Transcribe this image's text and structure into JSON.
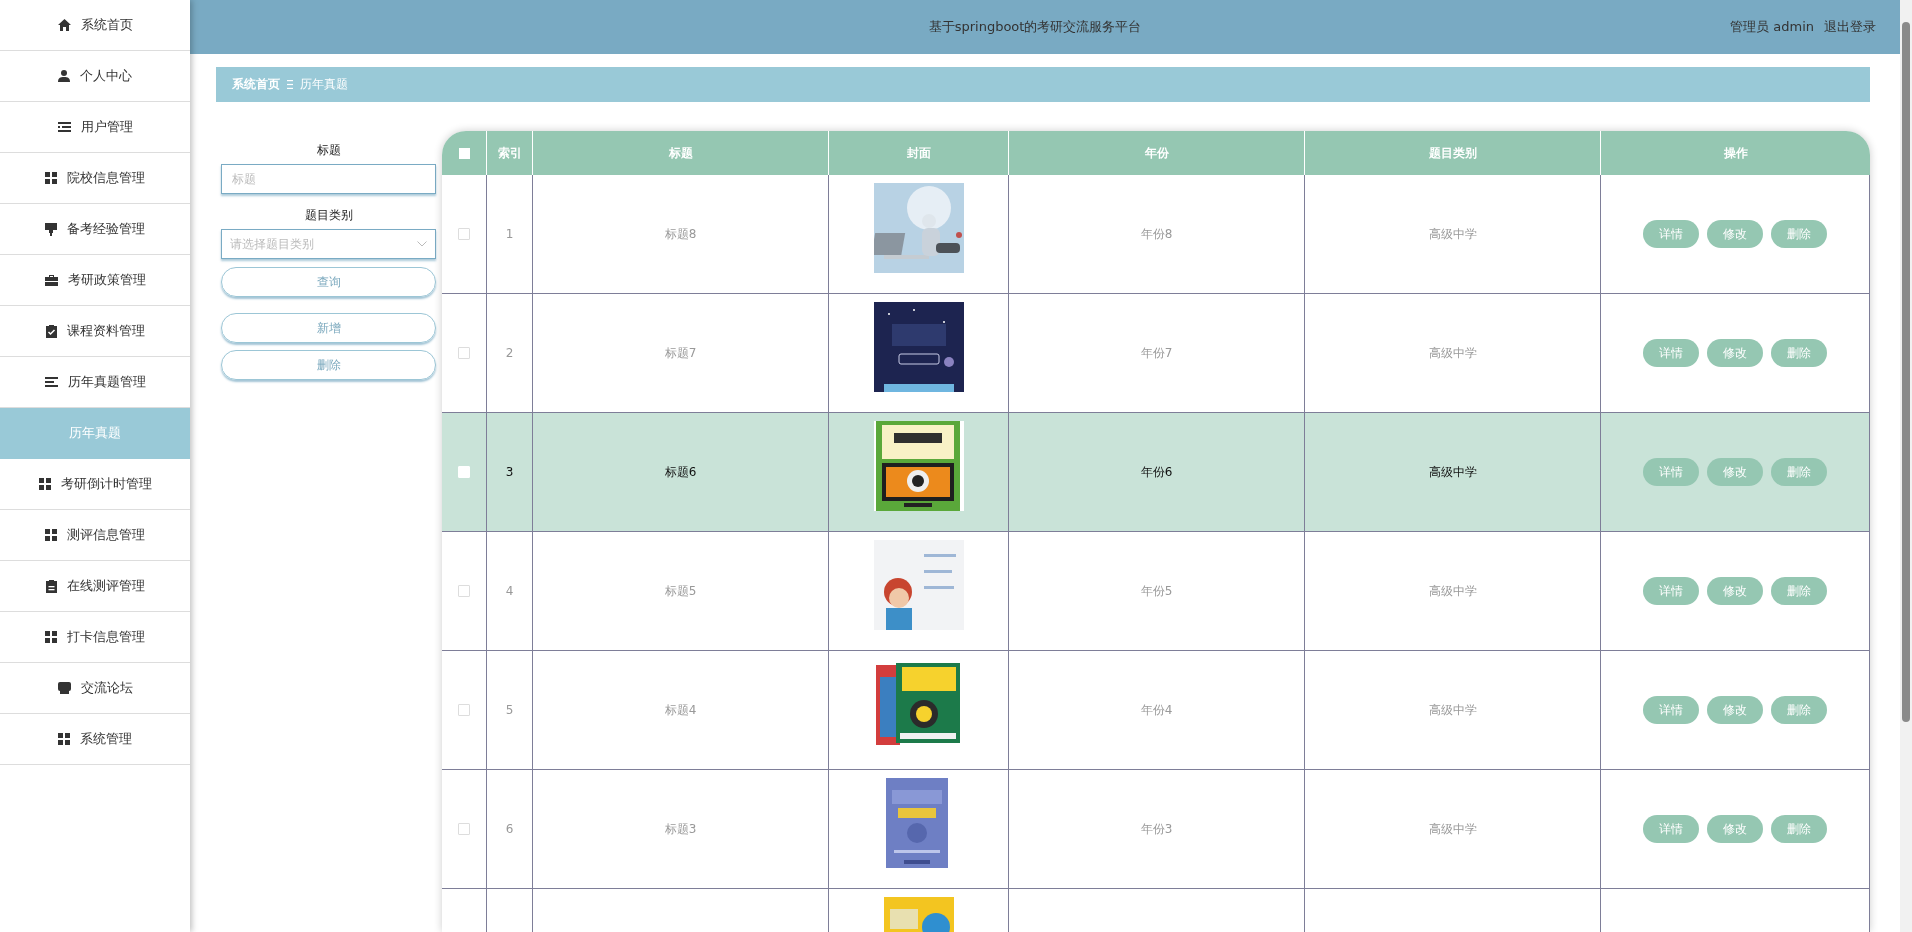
{
  "sidebar": {
    "items": [
      {
        "label": "系统首页",
        "selected": false
      },
      {
        "label": "个人中心",
        "selected": false
      },
      {
        "label": "用户管理",
        "selected": false
      },
      {
        "label": "院校信息管理",
        "selected": false
      },
      {
        "label": "备考经验管理",
        "selected": false
      },
      {
        "label": "考研政策管理",
        "selected": false
      },
      {
        "label": "课程资料管理",
        "selected": false
      },
      {
        "label": "历年真题管理",
        "selected": false
      },
      {
        "label": "历年真题",
        "selected": true
      },
      {
        "label": "考研倒计时管理",
        "selected": false
      },
      {
        "label": "测评信息管理",
        "selected": false
      },
      {
        "label": "在线测评管理",
        "selected": false
      },
      {
        "label": "打卡信息管理",
        "selected": false
      },
      {
        "label": "交流论坛",
        "selected": false
      },
      {
        "label": "系统管理",
        "selected": false
      }
    ]
  },
  "header": {
    "title": "基于springboot的考研交流服务平台",
    "user": "管理员 admin",
    "logout": "退出登录"
  },
  "breadcrumb": {
    "home": "系统首页",
    "current": "历年真题"
  },
  "search_form": {
    "title_label": "标题",
    "title_field": {
      "placeholder": "标题"
    },
    "category_label": "题目类别",
    "category_select": {
      "placeholder": "请选择题目类别"
    },
    "buttons": [
      "查询",
      "新增",
      "删除"
    ]
  },
  "table": {
    "select_all_checked": false,
    "columns": [
      "索引",
      "标题",
      "封面",
      "年份",
      "题目类别",
      "操作"
    ],
    "rows": [
      {
        "index": "1",
        "title": "标题8",
        "cover": {
          "kind": "picture"
        },
        "year": "年份8",
        "category": "高级中学",
        "actions": [
          "详情",
          "修改",
          "删除"
        ],
        "selected": false
      },
      {
        "index": "2",
        "title": "标题7",
        "cover": {
          "kind": "picture"
        },
        "year": "年份7",
        "category": "高级中学",
        "actions": [
          "详情",
          "修改",
          "删除"
        ],
        "selected": false
      },
      {
        "index": "3",
        "title": "标题6",
        "cover": {
          "kind": "picture"
        },
        "year": "年份6",
        "category": "高级中学",
        "actions": [
          "详情",
          "修改",
          "删除"
        ],
        "selected": true
      },
      {
        "index": "4",
        "title": "标题5",
        "cover": {
          "kind": "picture"
        },
        "year": "年份5",
        "category": "高级中学",
        "actions": [
          "详情",
          "修改",
          "删除"
        ],
        "selected": false
      },
      {
        "index": "5",
        "title": "标题4",
        "cover": {
          "kind": "picture"
        },
        "year": "年份4",
        "category": "高级中学",
        "actions": [
          "详情",
          "修改",
          "删除"
        ],
        "selected": false
      },
      {
        "index": "6",
        "title": "标题3",
        "cover": {
          "kind": "picture"
        },
        "year": "年份3",
        "category": "高级中学",
        "actions": [
          "详情",
          "修改",
          "删除"
        ],
        "selected": false
      },
      {
        "cover": {
          "kind": "picture"
        }
      }
    ]
  }
}
